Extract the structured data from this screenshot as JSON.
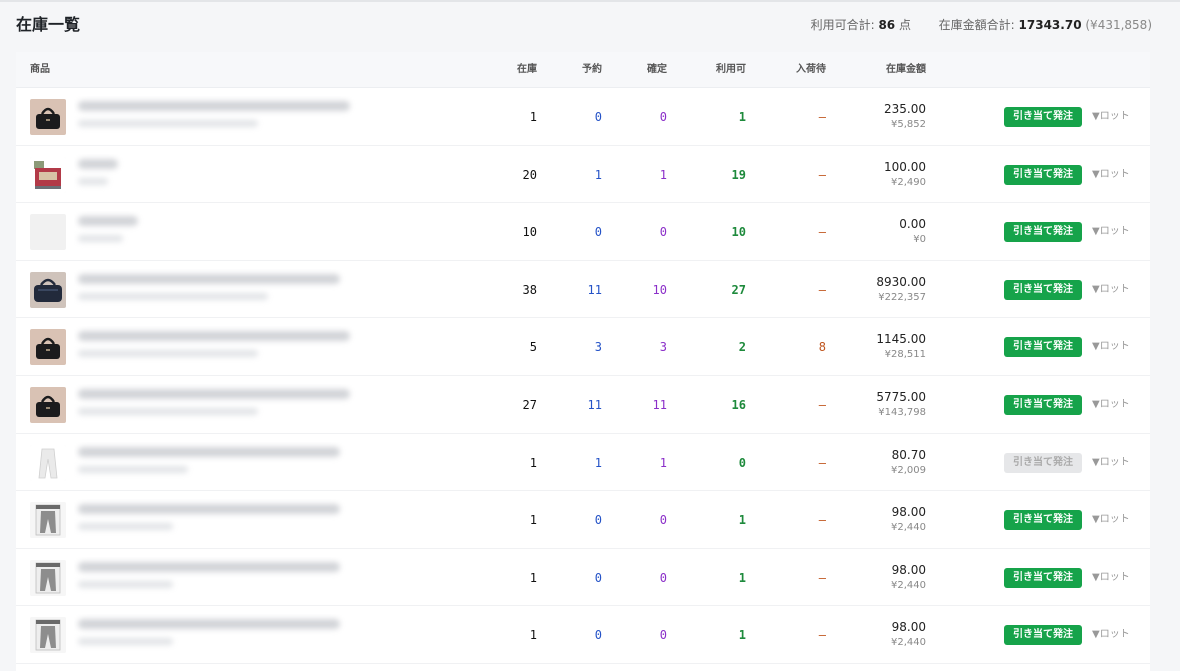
{
  "header": {
    "title": "在庫一覧",
    "available_label": "利用可合計:",
    "available_total": "86",
    "available_unit": "点",
    "amount_label": "在庫金額合計:",
    "amount_total": "17343.70",
    "amount_total_jpy": "(¥431,858)"
  },
  "columns": {
    "product": "商品",
    "stock": "在庫",
    "reserved": "予約",
    "confirmed": "確定",
    "available": "利用可",
    "incoming": "入荷待",
    "amount": "在庫金額"
  },
  "colors": {
    "reserved": "#2553c7",
    "confirmed": "#8b2fc9",
    "available": "#1e8a3c",
    "incoming": "#c0561f",
    "allocate_button": "#16a34a"
  },
  "rows": [
    {
      "thumb": "black-bag",
      "stock": "1",
      "reserved": "0",
      "confirmed": "0",
      "available": "1",
      "incoming": "–",
      "amount_usd": "235.00",
      "amount_jpy": "¥5,852",
      "allocate_label": "引き当て発注",
      "allocate_enabled": true,
      "lot_label": "▼ロット"
    },
    {
      "thumb": "red-product",
      "stock": "20",
      "reserved": "1",
      "confirmed": "1",
      "available": "19",
      "incoming": "–",
      "amount_usd": "100.00",
      "amount_jpy": "¥2,490",
      "allocate_label": "引き当て発注",
      "allocate_enabled": true,
      "lot_label": "▼ロット"
    },
    {
      "thumb": "empty",
      "stock": "10",
      "reserved": "0",
      "confirmed": "0",
      "available": "10",
      "incoming": "–",
      "amount_usd": "0.00",
      "amount_jpy": "¥0",
      "allocate_label": "引き当て発注",
      "allocate_enabled": true,
      "lot_label": "▼ロット"
    },
    {
      "thumb": "navy-bag",
      "stock": "38",
      "reserved": "11",
      "confirmed": "10",
      "available": "27",
      "incoming": "–",
      "amount_usd": "8930.00",
      "amount_jpy": "¥222,357",
      "allocate_label": "引き当て発注",
      "allocate_enabled": true,
      "lot_label": "▼ロット"
    },
    {
      "thumb": "black-bag",
      "stock": "5",
      "reserved": "3",
      "confirmed": "3",
      "available": "2",
      "incoming": "8",
      "amount_usd": "1145.00",
      "amount_jpy": "¥28,511",
      "allocate_label": "引き当て発注",
      "allocate_enabled": true,
      "lot_label": "▼ロット"
    },
    {
      "thumb": "black-bag",
      "stock": "27",
      "reserved": "11",
      "confirmed": "11",
      "available": "16",
      "incoming": "–",
      "amount_usd": "5775.00",
      "amount_jpy": "¥143,798",
      "allocate_label": "引き当て発注",
      "allocate_enabled": true,
      "lot_label": "▼ロット"
    },
    {
      "thumb": "white-pants",
      "stock": "1",
      "reserved": "1",
      "confirmed": "1",
      "available": "0",
      "incoming": "–",
      "amount_usd": "80.70",
      "amount_jpy": "¥2,009",
      "allocate_label": "引き当て発注",
      "allocate_enabled": false,
      "lot_label": "▼ロット"
    },
    {
      "thumb": "grey-pants",
      "stock": "1",
      "reserved": "0",
      "confirmed": "0",
      "available": "1",
      "incoming": "–",
      "amount_usd": "98.00",
      "amount_jpy": "¥2,440",
      "allocate_label": "引き当て発注",
      "allocate_enabled": true,
      "lot_label": "▼ロット"
    },
    {
      "thumb": "grey-pants",
      "stock": "1",
      "reserved": "0",
      "confirmed": "0",
      "available": "1",
      "incoming": "–",
      "amount_usd": "98.00",
      "amount_jpy": "¥2,440",
      "allocate_label": "引き当て発注",
      "allocate_enabled": true,
      "lot_label": "▼ロット"
    },
    {
      "thumb": "grey-pants",
      "stock": "1",
      "reserved": "0",
      "confirmed": "0",
      "available": "1",
      "incoming": "–",
      "amount_usd": "98.00",
      "amount_jpy": "¥2,440",
      "allocate_label": "引き当て発注",
      "allocate_enabled": true,
      "lot_label": "▼ロット"
    }
  ]
}
